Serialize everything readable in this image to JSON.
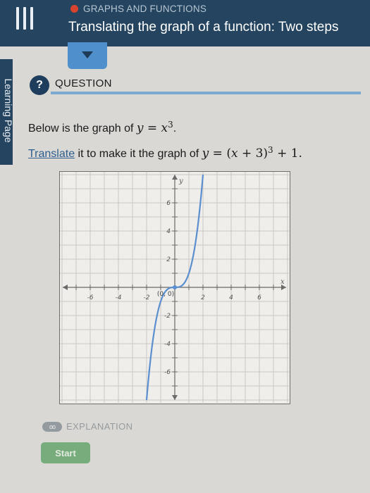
{
  "header": {
    "topic": "GRAPHS AND FUNCTIONS",
    "title": "Translating the graph of a function: Two steps"
  },
  "sidebar": {
    "label": "Learning Page"
  },
  "question": {
    "badge": "?",
    "label": "QUESTION",
    "line1_prefix": "Below is the graph of ",
    "line1_lhs": "y",
    "line1_eq": " = ",
    "line1_x": "x",
    "line1_exp": "3",
    "line1_end": ".",
    "line2_link": "Translate",
    "line2_prefix": " it to make it the graph of ",
    "line2_lhs": "y",
    "line2_eq": " = (",
    "line2_x": "x",
    "line2_plus": " + 3)",
    "line2_exp": "3",
    "line2_end": " + 1."
  },
  "graph": {
    "x_axis_label": "x",
    "y_axis_label": "y",
    "x_tick_labels": [
      {
        "value": -6,
        "label": "-6"
      },
      {
        "value": -4,
        "label": "-4"
      },
      {
        "value": -2,
        "label": "-2"
      },
      {
        "value": 2,
        "label": "2"
      },
      {
        "value": 4,
        "label": "4"
      },
      {
        "value": 6,
        "label": "6"
      }
    ],
    "y_tick_labels": [
      {
        "value": 6,
        "label": "6"
      },
      {
        "value": 4,
        "label": "4"
      },
      {
        "value": 2,
        "label": "2"
      },
      {
        "value": -2,
        "label": "-2"
      },
      {
        "value": -4,
        "label": "-4"
      },
      {
        "value": -6,
        "label": "-6"
      }
    ],
    "xlim": [
      -8,
      8
    ],
    "ylim": [
      -8,
      8
    ],
    "point_label": "(0, 0)",
    "curve_color": "#5b8fd0",
    "function": "y = x^3"
  },
  "explanation": {
    "icon_text": "oo",
    "label": "EXPLANATION"
  },
  "actions": {
    "start_label": "Start"
  }
}
